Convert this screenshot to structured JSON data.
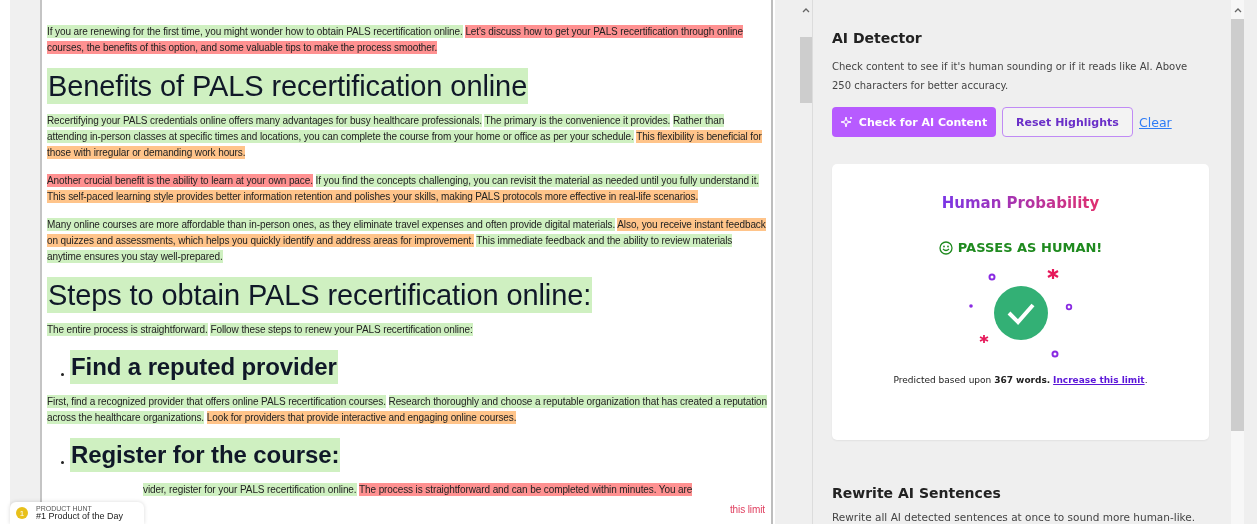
{
  "editor": {
    "content": [
      {
        "kind": "paragraph",
        "segments": [
          {
            "text": "If you are renewing for the first time, you might wonder how to obtain PALS recertification online.",
            "color": "#cff0c1"
          },
          {
            "text": "Let's discuss how to get your PALS recertification through online courses, the benefits of this option, and some valuable tips to make the process smoother.",
            "color": "#ff9191"
          }
        ]
      },
      {
        "kind": "heading",
        "text": "Benefits of PALS recertification online",
        "color": "#cff0c1"
      },
      {
        "kind": "paragraph",
        "segments": [
          {
            "text": "Recertifying your PALS credentials online offers many advantages for busy healthcare professionals.",
            "color": "#cff0c1"
          },
          {
            "text": "The primary is the convenience it provides.",
            "color": "#cff0c1"
          },
          {
            "text": "Rather than attending in-person classes at specific times and locations, you can complete the course from your home or office as per your schedule.",
            "color": "#cff0c1"
          },
          {
            "text": "This flexibility is beneficial for those with irregular or demanding work hours.",
            "color": "#ffc48a"
          }
        ]
      },
      {
        "kind": "paragraph",
        "segments": [
          {
            "text": "Another crucial benefit is the ability to learn at your own pace.",
            "color": "#ff9191"
          },
          {
            "text": "If you find the concepts challenging, you can revisit the material as needed until you fully understand it.",
            "color": "#cff0c1"
          },
          {
            "text": "This self-paced learning style provides better information retention and polishes your skills, making PALS protocols more effective in real-life scenarios.",
            "color": "#ffc48a"
          }
        ]
      },
      {
        "kind": "paragraph",
        "segments": [
          {
            "text": "Many online courses are more affordable than in-person ones, as they eliminate travel expenses and often provide digital materials.",
            "color": "#cff0c1"
          },
          {
            "text": "Also, you receive instant feedback on quizzes and assessments, which helps you quickly identify and address areas for improvement.",
            "color": "#ffc48a"
          },
          {
            "text": "This immediate feedback and the ability to review materials anytime ensures you stay well-prepared.",
            "color": "#cff0c1"
          }
        ]
      },
      {
        "kind": "heading",
        "text": "Steps to obtain PALS recertification online:",
        "color": "#cff0c1"
      },
      {
        "kind": "paragraph",
        "segments": [
          {
            "text": "The entire process is straightforward.",
            "color": "#cff0c1"
          },
          {
            "text": "Follow these steps to renew your PALS recertification online:",
            "color": "#cff0c1"
          }
        ]
      },
      {
        "kind": "subheading",
        "text": "Find a reputed provider",
        "color": "#cff0c1"
      },
      {
        "kind": "paragraph",
        "segments": [
          {
            "text": "First, find a recognized provider that offers online PALS recertification courses.",
            "color": "#cff0c1"
          },
          {
            "text": "Research thoroughly and choose a reputable organization that has created a reputation across the healthcare organizations.",
            "color": "#cff0c1"
          },
          {
            "text": "Look for providers that provide interactive and engaging online courses.",
            "color": "#ffc48a"
          }
        ]
      },
      {
        "kind": "subheading",
        "text": "Register for the course:",
        "color": "#cff0c1"
      },
      {
        "kind": "paragraph",
        "segments": [
          {
            "text": "vider, register for your PALS recertification online.",
            "color": "#cff0c1"
          },
          {
            "text": "The process is straightforward and can be completed within minutes. You are",
            "color": "#ff9191"
          }
        ]
      }
    ],
    "limit_note": "this limit"
  },
  "product_hunt": {
    "rank": "1",
    "label": "PRODUCT HUNT",
    "title": "#1 Product of the Day"
  },
  "detector": {
    "title": "AI Detector",
    "description": "Check content to see if it's human sounding or if it reads like AI. Above 250 characters for better accuracy.",
    "buttons": [
      {
        "label": "Check for AI Content",
        "kind": "primary"
      },
      {
        "label": "Reset Highlights",
        "kind": "outline"
      },
      {
        "label": "Clear",
        "kind": "link"
      }
    ],
    "result": {
      "title": "Human Probability",
      "verdict": "PASSES AS HUMAN!",
      "note": "Predicted based upon **367 words.** ",
      "note_link": "Increase this limit",
      "note_end": "."
    }
  },
  "rewrite": {
    "title": "Rewrite AI Sentences",
    "description": "Rewrite all AI detected sentences at once to sound more human-like."
  }
}
